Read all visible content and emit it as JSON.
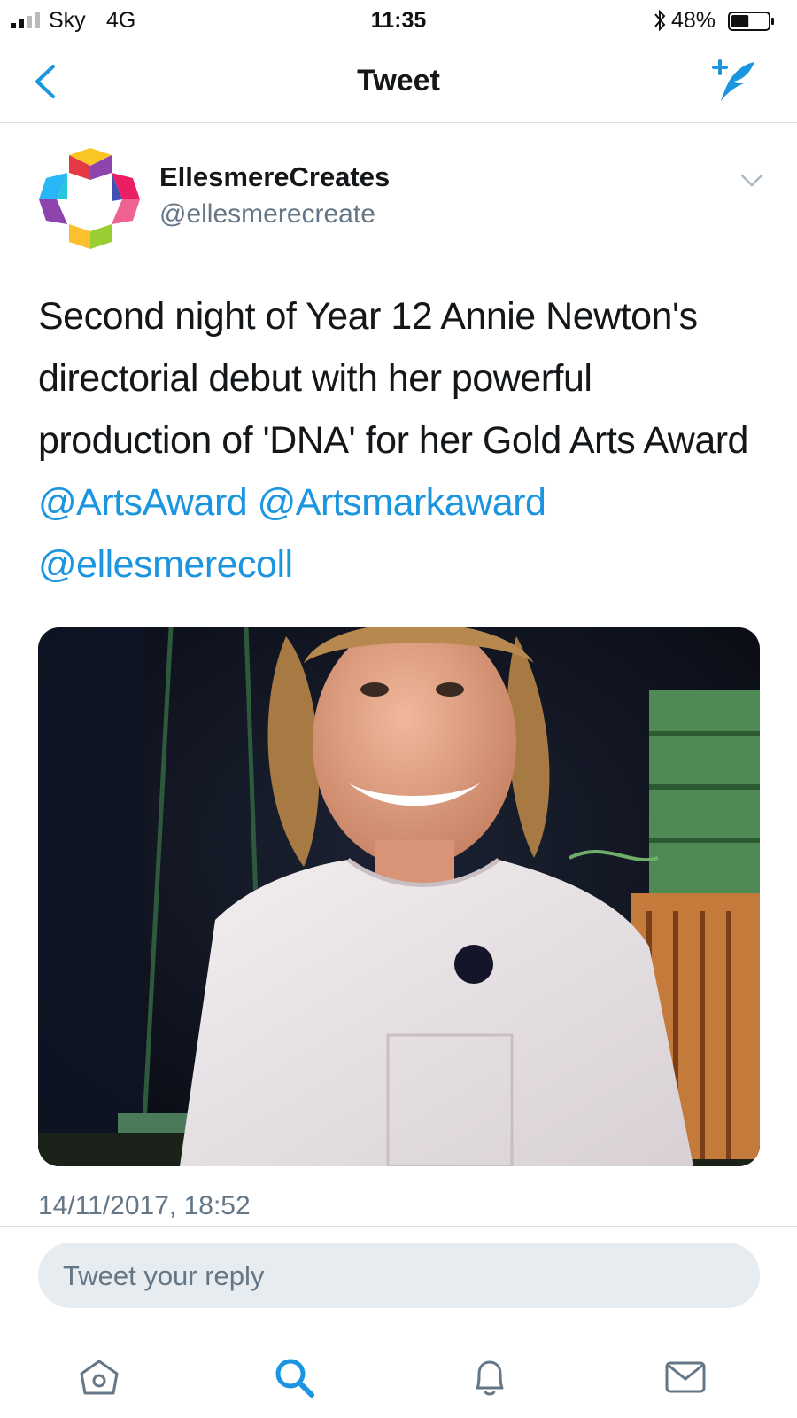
{
  "status_bar": {
    "carrier": "Sky",
    "network": "4G",
    "time": "11:35",
    "battery_percent": "48%",
    "battery_level": 0.48,
    "signal_bars_filled": 2
  },
  "nav": {
    "title": "Tweet",
    "back_icon": "chevron-left-icon",
    "compose_icon": "compose-tweet-icon"
  },
  "tweet": {
    "author_name": "EllesmereCreates",
    "author_handle": "@ellesmerecreate",
    "text_plain": "Second night of Year 12 Annie Newton's directorial debut with her powerful production of 'DNA' for her Gold Arts Award",
    "mentions": [
      "@ArtsAward",
      "@Artsmarkaward",
      "@ellesmerecoll"
    ],
    "timestamp": "14/11/2017, 18:52"
  },
  "reply": {
    "placeholder": "Tweet your reply"
  },
  "tab_bar": {
    "items": [
      {
        "icon": "home-icon",
        "active": false
      },
      {
        "icon": "search-icon",
        "active": true
      },
      {
        "icon": "bell-icon",
        "active": false
      },
      {
        "icon": "mail-icon",
        "active": false
      }
    ]
  },
  "colors": {
    "accent": "#1b95e0",
    "text": "#14171a",
    "secondary_text": "#657786",
    "reply_bg": "#e6ecf0",
    "divider": "#d8dee3"
  }
}
